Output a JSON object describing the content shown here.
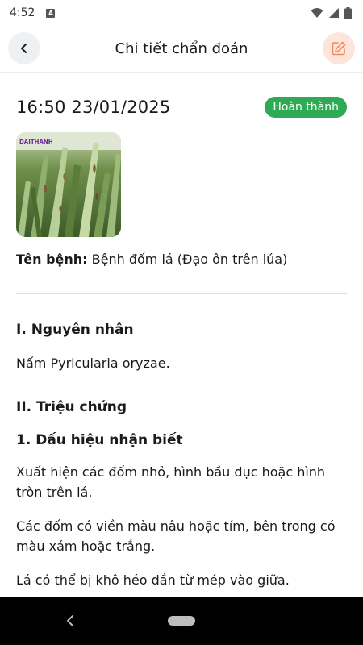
{
  "status_bar": {
    "time": "4:52"
  },
  "header": {
    "title": "Chi tiết chẩn đoán",
    "back_icon": "chevron-left-icon",
    "edit_icon": "edit-icon",
    "edit_color": "#f08a5d"
  },
  "diagnosis": {
    "datetime": "16:50 23/01/2025",
    "status": "Hoàn thành",
    "status_color": "#2eaa55",
    "image_watermark": "DAITHANH",
    "disease_label": "Tên bệnh:",
    "disease_name": "Bệnh đốm lá (Đạo ôn trên lúa)"
  },
  "sections": {
    "cause_heading": "I. Nguyên nhân",
    "cause_text": "Nấm Pyricularia oryzae.",
    "symptoms_heading": "II. Triệu chứng",
    "signs_heading": "1. Dấu hiệu nhận biết",
    "paragraphs": [
      "Xuất hiện các đốm nhỏ, hình bầu dục hoặc hình tròn trên lá.",
      "Các đốm có viền màu nâu hoặc tím, bên trong có màu xám hoặc trắng.",
      "Lá có thể bị khô héo dần từ mép vào giữa."
    ]
  }
}
